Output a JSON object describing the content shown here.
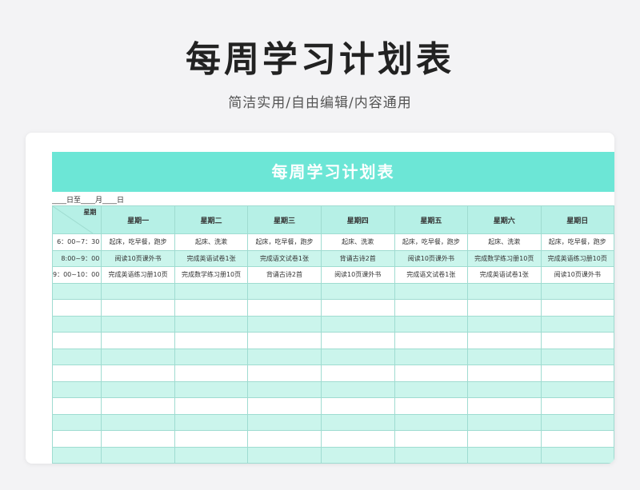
{
  "page": {
    "title": "每周学习计划表",
    "subtitle": "简洁实用/自由编辑/内容通用"
  },
  "sheet": {
    "banner_title": "每周学习计划表",
    "date_line": "____日至____月____日",
    "corner_label": "星期",
    "days": [
      "星期一",
      "星期二",
      "星期三",
      "星期四",
      "星期五",
      "星期六",
      "星期日"
    ],
    "rows": [
      {
        "time": "6：00~7：30",
        "cells": [
          "起床，吃早餐，跑步",
          "起床、洗漱",
          "起床，吃早餐，跑步",
          "起床、洗漱",
          "起床，吃早餐，跑步",
          "起床、洗漱",
          "起床，吃早餐，跑步"
        ]
      },
      {
        "time": "8:00~9：00",
        "cells": [
          "阅读10页课外书",
          "完成英语试卷1张",
          "完成语文试卷1张",
          "背诵古诗2首",
          "阅读10页课外书",
          "完成数学练习册10页",
          "完成英语练习册10页"
        ]
      },
      {
        "time": "9：00~10：00",
        "cells": [
          "完成英语练习册10页",
          "完成数学练习册10页",
          "背诵古诗2首",
          "阅读10页课外书",
          "完成语文试卷1张",
          "完成英语试卷1张",
          "阅读10页课外书"
        ]
      }
    ],
    "empty_rows": 11
  },
  "colors": {
    "banner": "#6ce6d6",
    "header_row": "#b6f0e6",
    "stripe": "#cbf5ec",
    "grid": "#9fdcd1"
  }
}
